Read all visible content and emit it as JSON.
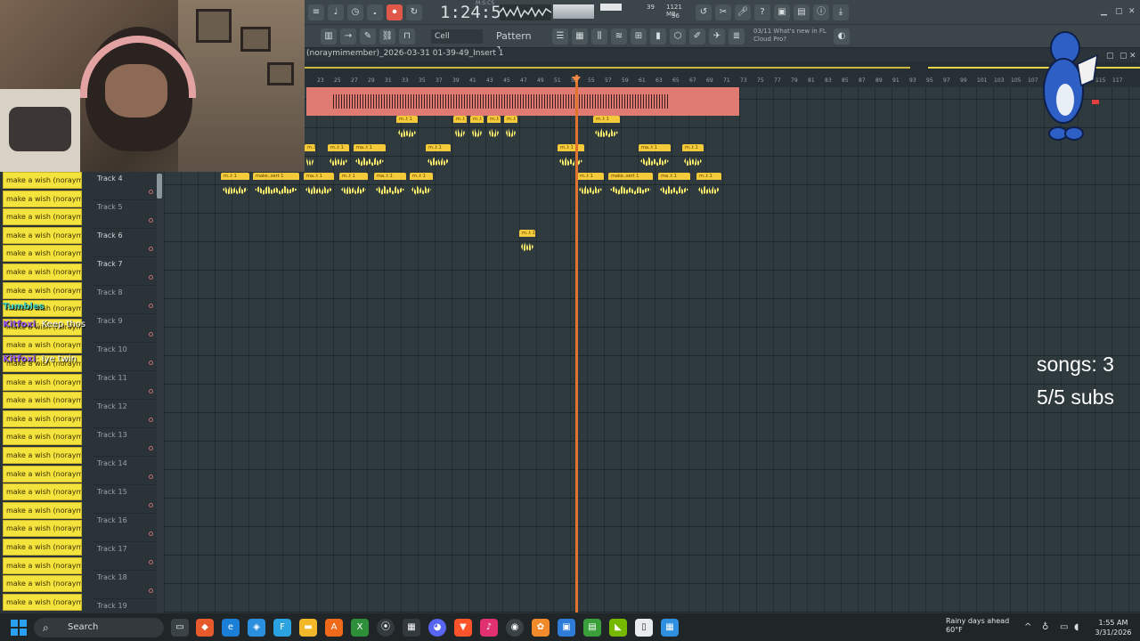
{
  "toolbar": {
    "time": "1:24:53",
    "time_sub": "M:S:CS",
    "cpu_mem": "1121 MB",
    "cpu_val1": "39",
    "cpu_val2": "56",
    "snap": "Cell",
    "pattern": "Pattern 1",
    "news_line1": "03/11 What's new in FL",
    "news_line2": "Cloud Pro?"
  },
  "playlist": {
    "title": "(noraymimember)_2026-03-31 01-39-49_Insert 1",
    "ruler_ticks": [
      "23",
      "25",
      "27",
      "29",
      "31",
      "33",
      "35",
      "37",
      "39",
      "41",
      "43",
      "45",
      "47",
      "49",
      "51",
      "53",
      "55",
      "57",
      "59",
      "61",
      "63",
      "65",
      "67",
      "69",
      "71",
      "73",
      "75",
      "77",
      "79",
      "81",
      "83",
      "85",
      "87",
      "89",
      "91",
      "93",
      "95",
      "97",
      "99",
      "101",
      "103",
      "105",
      "107",
      "109",
      "111",
      "113",
      "115",
      "117"
    ],
    "tracks": [
      "Track 4",
      "Track 5",
      "Track 6",
      "Track 7",
      "Track 8",
      "Track 9",
      "Track 10",
      "Track 11",
      "Track 12",
      "Track 13",
      "Track 14",
      "Track 15",
      "Track 16",
      "Track 17",
      "Track 18",
      "Track 19"
    ],
    "clip_labels": {
      "m1": "m..t 1",
      "ma1": "ma..t 1",
      "make_sert": "make..sert 1"
    }
  },
  "chat": {
    "line_text": "make a wish (noraymime",
    "msg1_user": "Kitfoxi",
    "msg1_text": ": Keep those",
    "msg2_user": "Kitfoxi",
    "msg2_text": ": Iye twin",
    "msg0_user": "Tumbles"
  },
  "overlay": {
    "songs": "songs: 3",
    "subs": "5/5 subs"
  },
  "taskbar": {
    "search": "Search",
    "weather_line1": "Rainy days ahead",
    "weather_line2": "60°F",
    "clock_time": "1:55 AM",
    "clock_date": "3/31/2026"
  }
}
